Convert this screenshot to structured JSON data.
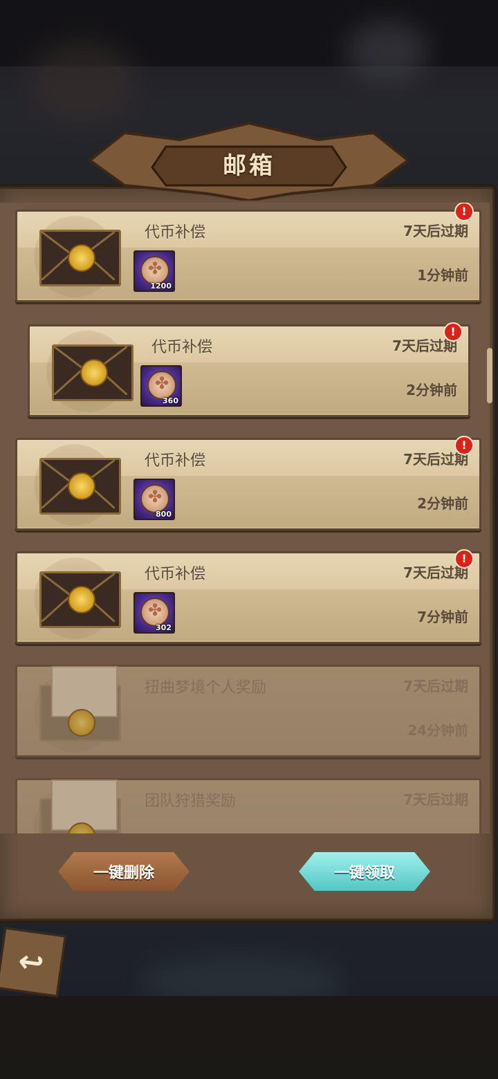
{
  "window": {
    "title": "邮箱"
  },
  "mails": [
    {
      "title": "代币补偿",
      "expire": "7天后过期",
      "time": "1分钟前",
      "qty": "1200",
      "unread": true
    },
    {
      "title": "代币补偿",
      "expire": "7天后过期",
      "time": "2分钟前",
      "qty": "360",
      "unread": true
    },
    {
      "title": "代币补偿",
      "expire": "7天后过期",
      "time": "2分钟前",
      "qty": "800",
      "unread": true
    },
    {
      "title": "代币补偿",
      "expire": "7天后过期",
      "time": "7分钟前",
      "qty": "302",
      "unread": true
    },
    {
      "title": "扭曲梦境个人奖励",
      "expire": "7天后过期",
      "time": "24分钟前",
      "unread": false
    },
    {
      "title": "团队狩猎奖励",
      "expire": "7天后过期",
      "time": "",
      "unread": false
    }
  ],
  "badge": {
    "symbol": "!"
  },
  "footer": {
    "delete_all": "一键删除",
    "claim_all": "一键领取"
  },
  "icons": {
    "back": "back-arrow-icon",
    "mail": "envelope-icon",
    "item": "coin-icon"
  }
}
